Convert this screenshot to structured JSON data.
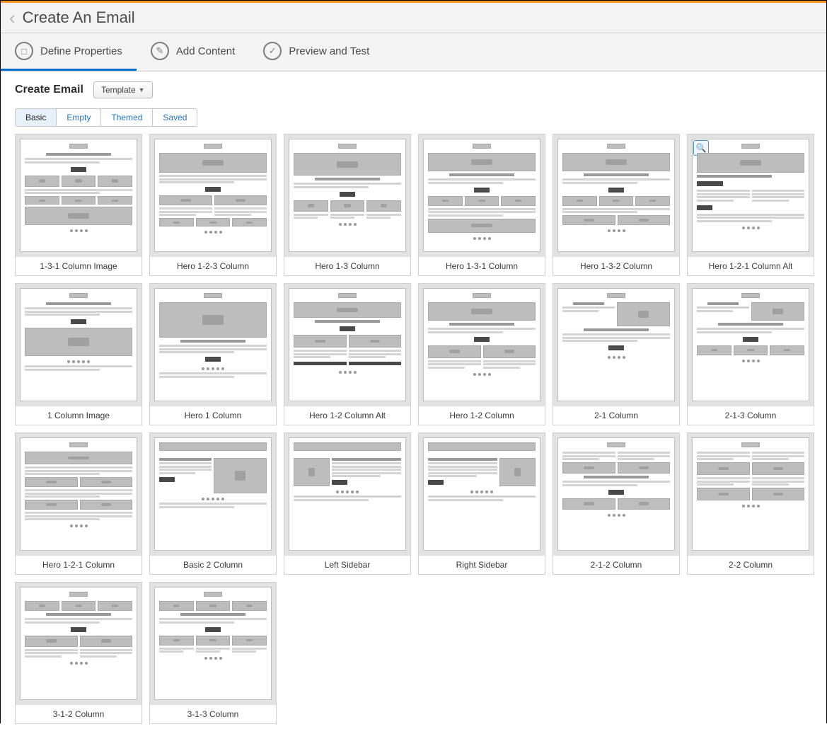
{
  "header": {
    "title": "Create An Email"
  },
  "steps": [
    {
      "label": "Define Properties",
      "icon": "□",
      "active": true
    },
    {
      "label": "Add Content",
      "icon": "✎",
      "active": false
    },
    {
      "label": "Preview and Test",
      "icon": "✓",
      "active": false
    }
  ],
  "section": {
    "title": "Create Email",
    "dropdown_label": "Template"
  },
  "tabs": [
    {
      "label": "Basic",
      "active": true
    },
    {
      "label": "Empty",
      "active": false
    },
    {
      "label": "Themed",
      "active": false
    },
    {
      "label": "Saved",
      "active": false
    }
  ],
  "templates": [
    {
      "label": "1-3-1 Column Image",
      "kind": "c131",
      "zoom": false
    },
    {
      "label": "Hero 1-2-3 Column",
      "kind": "h123",
      "zoom": false
    },
    {
      "label": "Hero 1-3 Column",
      "kind": "h13",
      "zoom": false
    },
    {
      "label": "Hero 1-3-1 Column",
      "kind": "h131",
      "zoom": false
    },
    {
      "label": "Hero 1-3-2 Column",
      "kind": "h132",
      "zoom": false
    },
    {
      "label": "Hero 1-2-1 Column Alt",
      "kind": "h121alt",
      "zoom": true
    },
    {
      "label": "1 Column Image",
      "kind": "c1",
      "zoom": false
    },
    {
      "label": "Hero 1 Column",
      "kind": "h1",
      "zoom": false
    },
    {
      "label": "Hero 1-2 Column Alt",
      "kind": "h12alt",
      "zoom": false
    },
    {
      "label": "Hero 1-2 Column",
      "kind": "h12",
      "zoom": false
    },
    {
      "label": "2-1 Column",
      "kind": "c21",
      "zoom": false
    },
    {
      "label": "2-1-3 Column",
      "kind": "c213",
      "zoom": false
    },
    {
      "label": "Hero 1-2-1 Column",
      "kind": "h121",
      "zoom": false
    },
    {
      "label": "Basic 2 Column",
      "kind": "b2",
      "zoom": false
    },
    {
      "label": "Left Sidebar",
      "kind": "lsb",
      "zoom": false
    },
    {
      "label": "Right Sidebar",
      "kind": "rsb",
      "zoom": false
    },
    {
      "label": "2-1-2 Column",
      "kind": "c212",
      "zoom": false
    },
    {
      "label": "2-2 Column",
      "kind": "c22",
      "zoom": false
    },
    {
      "label": "3-1-2 Column",
      "kind": "c312",
      "zoom": false
    },
    {
      "label": "3-1-3 Column",
      "kind": "c313",
      "zoom": false
    }
  ]
}
